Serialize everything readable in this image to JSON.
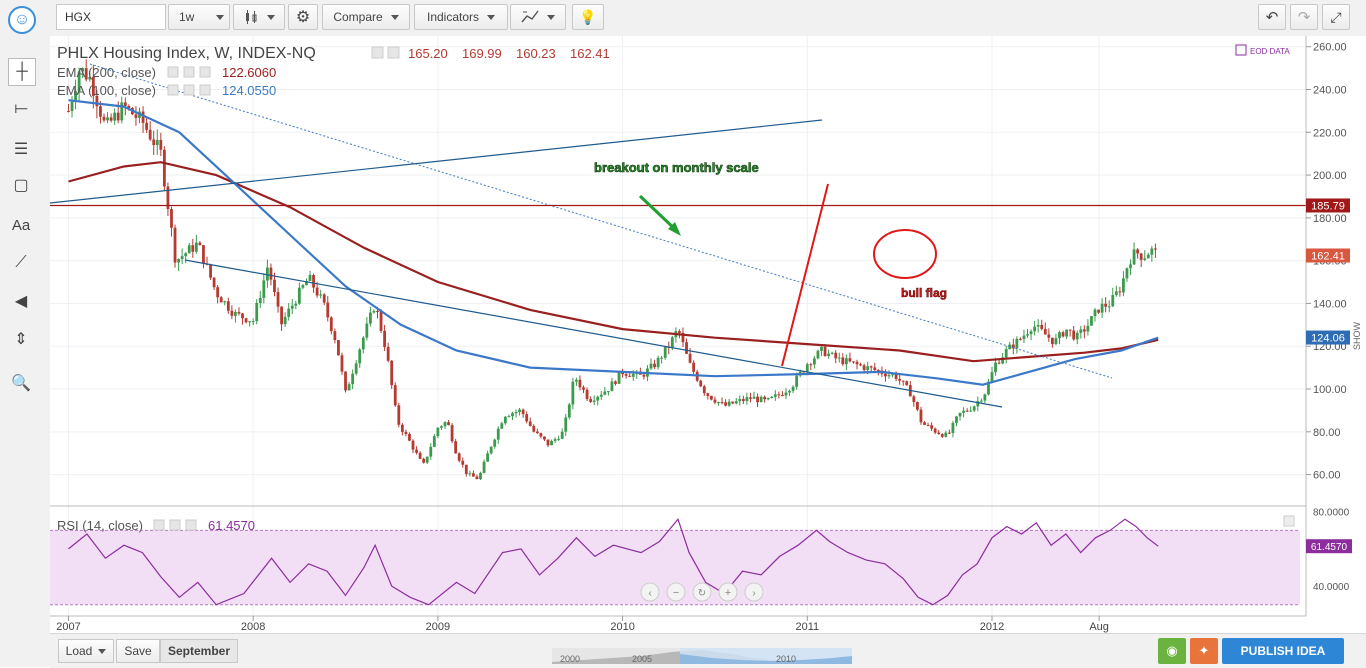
{
  "toolbar": {
    "symbol": "HGX",
    "interval": "1w",
    "compare_label": "Compare",
    "indicators_label": "Indicators"
  },
  "legend": {
    "title": "PHLX Housing Index, W, INDEX-NQ",
    "ohlc": [
      "165.20",
      "169.99",
      "160.23",
      "162.41"
    ],
    "ema200_label": "EMA (200, close)",
    "ema200_value": "122.6060",
    "ema100_label": "EMA (100, close)",
    "ema100_value": "124.0550",
    "eod_label": "EOD DATA",
    "rsi_label": "RSI (14, close)",
    "rsi_value": "61.4570",
    "show_label": "SHOW"
  },
  "annotations": {
    "breakout": "breakout on monthly scale",
    "bull_flag": "bull flag"
  },
  "bottom": {
    "load_label": "Load",
    "save_label": "Save",
    "layout_name": "September",
    "publish_label": "PUBLISH IDEA",
    "nav_years": [
      "2000",
      "2005",
      "2010"
    ]
  },
  "colors": {
    "up": "#3c9a4e",
    "down": "#b43a32",
    "ema200": "#9a1f1f",
    "ema100": "#3b78c8",
    "trend": "#1e5b8e",
    "rsi": "#8c2d9e",
    "annotation_red": "#e01818",
    "annotation_green": "#1fa030"
  },
  "chart_data": {
    "type": "candlestick",
    "title": "PHLX Housing Index, W, INDEX-NQ",
    "ylim": [
      50,
      265
    ],
    "y_ticks": [
      "260.00",
      "240.00",
      "220.00",
      "200.00",
      "180.00",
      "160.00",
      "140.00",
      "120.00",
      "100.00",
      "80.00",
      "60.00"
    ],
    "x_ticks": [
      "2007",
      "2008",
      "2009",
      "2010",
      "2011",
      "2012",
      "Aug"
    ],
    "last_price": "162.41",
    "horizontal_level": "185.79",
    "ema100_badge": "124.06",
    "rsi_ticks": [
      "80.0000",
      "40.0000"
    ],
    "rsi_ylim": [
      25,
      82
    ],
    "rsi_band": [
      30,
      70
    ],
    "close_series": [
      {
        "t": 2007.0,
        "v": 230
      },
      {
        "t": 2007.06,
        "v": 250
      },
      {
        "t": 2007.12,
        "v": 245
      },
      {
        "t": 2007.2,
        "v": 222
      },
      {
        "t": 2007.3,
        "v": 232
      },
      {
        "t": 2007.4,
        "v": 225
      },
      {
        "t": 2007.5,
        "v": 210
      },
      {
        "t": 2007.58,
        "v": 160
      },
      {
        "t": 2007.7,
        "v": 168
      },
      {
        "t": 2007.8,
        "v": 145
      },
      {
        "t": 2007.9,
        "v": 135
      },
      {
        "t": 2008.0,
        "v": 132
      },
      {
        "t": 2008.08,
        "v": 158
      },
      {
        "t": 2008.15,
        "v": 130
      },
      {
        "t": 2008.23,
        "v": 142
      },
      {
        "t": 2008.3,
        "v": 152
      },
      {
        "t": 2008.38,
        "v": 140
      },
      {
        "t": 2008.45,
        "v": 122
      },
      {
        "t": 2008.5,
        "v": 98
      },
      {
        "t": 2008.58,
        "v": 120
      },
      {
        "t": 2008.66,
        "v": 140
      },
      {
        "t": 2008.72,
        "v": 118
      },
      {
        "t": 2008.78,
        "v": 85
      },
      {
        "t": 2008.85,
        "v": 75
      },
      {
        "t": 2008.92,
        "v": 64
      },
      {
        "t": 2009.0,
        "v": 82
      },
      {
        "t": 2009.05,
        "v": 85
      },
      {
        "t": 2009.1,
        "v": 70
      },
      {
        "t": 2009.16,
        "v": 60
      },
      {
        "t": 2009.22,
        "v": 58
      },
      {
        "t": 2009.28,
        "v": 72
      },
      {
        "t": 2009.36,
        "v": 88
      },
      {
        "t": 2009.45,
        "v": 90
      },
      {
        "t": 2009.52,
        "v": 80
      },
      {
        "t": 2009.6,
        "v": 74
      },
      {
        "t": 2009.68,
        "v": 80
      },
      {
        "t": 2009.74,
        "v": 106
      },
      {
        "t": 2009.82,
        "v": 95
      },
      {
        "t": 2009.92,
        "v": 100
      },
      {
        "t": 2010.0,
        "v": 108
      },
      {
        "t": 2010.1,
        "v": 106
      },
      {
        "t": 2010.18,
        "v": 112
      },
      {
        "t": 2010.25,
        "v": 120
      },
      {
        "t": 2010.3,
        "v": 128
      },
      {
        "t": 2010.36,
        "v": 112
      },
      {
        "t": 2010.45,
        "v": 98
      },
      {
        "t": 2010.55,
        "v": 92
      },
      {
        "t": 2010.62,
        "v": 94
      },
      {
        "t": 2010.7,
        "v": 96
      },
      {
        "t": 2010.78,
        "v": 94
      },
      {
        "t": 2010.86,
        "v": 98
      },
      {
        "t": 2010.92,
        "v": 102
      },
      {
        "t": 2011.0,
        "v": 112
      },
      {
        "t": 2011.08,
        "v": 118
      },
      {
        "t": 2011.16,
        "v": 114
      },
      {
        "t": 2011.24,
        "v": 112
      },
      {
        "t": 2011.32,
        "v": 110
      },
      {
        "t": 2011.4,
        "v": 108
      },
      {
        "t": 2011.48,
        "v": 106
      },
      {
        "t": 2011.56,
        "v": 98
      },
      {
        "t": 2011.62,
        "v": 84
      },
      {
        "t": 2011.7,
        "v": 80
      },
      {
        "t": 2011.76,
        "v": 78
      },
      {
        "t": 2011.82,
        "v": 88
      },
      {
        "t": 2011.9,
        "v": 92
      },
      {
        "t": 2011.96,
        "v": 98
      },
      {
        "t": 2012.02,
        "v": 112
      },
      {
        "t": 2012.08,
        "v": 118
      },
      {
        "t": 2012.16,
        "v": 124
      },
      {
        "t": 2012.22,
        "v": 130
      },
      {
        "t": 2012.28,
        "v": 126
      },
      {
        "t": 2012.34,
        "v": 122
      },
      {
        "t": 2012.4,
        "v": 128
      },
      {
        "t": 2012.46,
        "v": 124
      },
      {
        "t": 2012.52,
        "v": 130
      },
      {
        "t": 2012.58,
        "v": 138
      },
      {
        "t": 2012.64,
        "v": 140
      },
      {
        "t": 2012.7,
        "v": 148
      },
      {
        "t": 2012.74,
        "v": 160
      },
      {
        "t": 2012.78,
        "v": 164
      },
      {
        "t": 2012.82,
        "v": 162
      },
      {
        "t": 2012.86,
        "v": 165
      },
      {
        "t": 2012.9,
        "v": 162.41
      }
    ],
    "ema200_series": [
      {
        "t": 2007.0,
        "v": 197
      },
      {
        "t": 2007.3,
        "v": 204
      },
      {
        "t": 2007.5,
        "v": 206
      },
      {
        "t": 2007.8,
        "v": 200
      },
      {
        "t": 2008.2,
        "v": 185
      },
      {
        "t": 2008.6,
        "v": 166
      },
      {
        "t": 2009.0,
        "v": 150
      },
      {
        "t": 2009.5,
        "v": 137
      },
      {
        "t": 2010.0,
        "v": 128
      },
      {
        "t": 2010.5,
        "v": 124
      },
      {
        "t": 2011.0,
        "v": 121
      },
      {
        "t": 2011.5,
        "v": 118
      },
      {
        "t": 2011.9,
        "v": 113
      },
      {
        "t": 2012.2,
        "v": 115
      },
      {
        "t": 2012.5,
        "v": 117
      },
      {
        "t": 2012.7,
        "v": 119
      },
      {
        "t": 2012.9,
        "v": 123
      }
    ],
    "ema100_series": [
      {
        "t": 2007.0,
        "v": 235
      },
      {
        "t": 2007.3,
        "v": 232
      },
      {
        "t": 2007.6,
        "v": 220
      },
      {
        "t": 2007.9,
        "v": 196
      },
      {
        "t": 2008.2,
        "v": 172
      },
      {
        "t": 2008.5,
        "v": 148
      },
      {
        "t": 2008.8,
        "v": 130
      },
      {
        "t": 2009.1,
        "v": 118
      },
      {
        "t": 2009.5,
        "v": 110
      },
      {
        "t": 2010.0,
        "v": 108
      },
      {
        "t": 2010.5,
        "v": 106
      },
      {
        "t": 2011.0,
        "v": 107
      },
      {
        "t": 2011.4,
        "v": 108
      },
      {
        "t": 2011.7,
        "v": 105
      },
      {
        "t": 2011.95,
        "v": 102
      },
      {
        "t": 2012.2,
        "v": 108
      },
      {
        "t": 2012.45,
        "v": 114
      },
      {
        "t": 2012.7,
        "v": 118
      },
      {
        "t": 2012.9,
        "v": 124
      }
    ],
    "rsi_series": [
      {
        "t": 2007.0,
        "v": 60
      },
      {
        "t": 2007.1,
        "v": 68
      },
      {
        "t": 2007.2,
        "v": 55
      },
      {
        "t": 2007.3,
        "v": 62
      },
      {
        "t": 2007.4,
        "v": 58
      },
      {
        "t": 2007.5,
        "v": 45
      },
      {
        "t": 2007.6,
        "v": 34
      },
      {
        "t": 2007.7,
        "v": 42
      },
      {
        "t": 2007.8,
        "v": 30
      },
      {
        "t": 2007.95,
        "v": 36
      },
      {
        "t": 2008.1,
        "v": 55
      },
      {
        "t": 2008.2,
        "v": 42
      },
      {
        "t": 2008.3,
        "v": 52
      },
      {
        "t": 2008.4,
        "v": 48
      },
      {
        "t": 2008.5,
        "v": 35
      },
      {
        "t": 2008.6,
        "v": 50
      },
      {
        "t": 2008.66,
        "v": 62
      },
      {
        "t": 2008.75,
        "v": 40
      },
      {
        "t": 2008.85,
        "v": 34
      },
      {
        "t": 2008.95,
        "v": 30
      },
      {
        "t": 2009.1,
        "v": 42
      },
      {
        "t": 2009.2,
        "v": 36
      },
      {
        "t": 2009.35,
        "v": 58
      },
      {
        "t": 2009.45,
        "v": 60
      },
      {
        "t": 2009.55,
        "v": 46
      },
      {
        "t": 2009.65,
        "v": 55
      },
      {
        "t": 2009.75,
        "v": 66
      },
      {
        "t": 2009.85,
        "v": 56
      },
      {
        "t": 2009.95,
        "v": 62
      },
      {
        "t": 2010.1,
        "v": 58
      },
      {
        "t": 2010.2,
        "v": 64
      },
      {
        "t": 2010.3,
        "v": 76
      },
      {
        "t": 2010.36,
        "v": 58
      },
      {
        "t": 2010.45,
        "v": 42
      },
      {
        "t": 2010.55,
        "v": 36
      },
      {
        "t": 2010.65,
        "v": 48
      },
      {
        "t": 2010.75,
        "v": 46
      },
      {
        "t": 2010.85,
        "v": 56
      },
      {
        "t": 2010.95,
        "v": 62
      },
      {
        "t": 2011.05,
        "v": 70
      },
      {
        "t": 2011.12,
        "v": 64
      },
      {
        "t": 2011.22,
        "v": 58
      },
      {
        "t": 2011.32,
        "v": 54
      },
      {
        "t": 2011.42,
        "v": 52
      },
      {
        "t": 2011.52,
        "v": 44
      },
      {
        "t": 2011.6,
        "v": 34
      },
      {
        "t": 2011.68,
        "v": 30
      },
      {
        "t": 2011.76,
        "v": 35
      },
      {
        "t": 2011.84,
        "v": 46
      },
      {
        "t": 2011.92,
        "v": 52
      },
      {
        "t": 2012.0,
        "v": 66
      },
      {
        "t": 2012.08,
        "v": 72
      },
      {
        "t": 2012.16,
        "v": 68
      },
      {
        "t": 2012.24,
        "v": 74
      },
      {
        "t": 2012.32,
        "v": 62
      },
      {
        "t": 2012.4,
        "v": 68
      },
      {
        "t": 2012.48,
        "v": 58
      },
      {
        "t": 2012.56,
        "v": 66
      },
      {
        "t": 2012.64,
        "v": 70
      },
      {
        "t": 2012.72,
        "v": 76
      },
      {
        "t": 2012.78,
        "v": 72
      },
      {
        "t": 2012.84,
        "v": 66
      },
      {
        "t": 2012.9,
        "v": 61.457
      }
    ]
  }
}
